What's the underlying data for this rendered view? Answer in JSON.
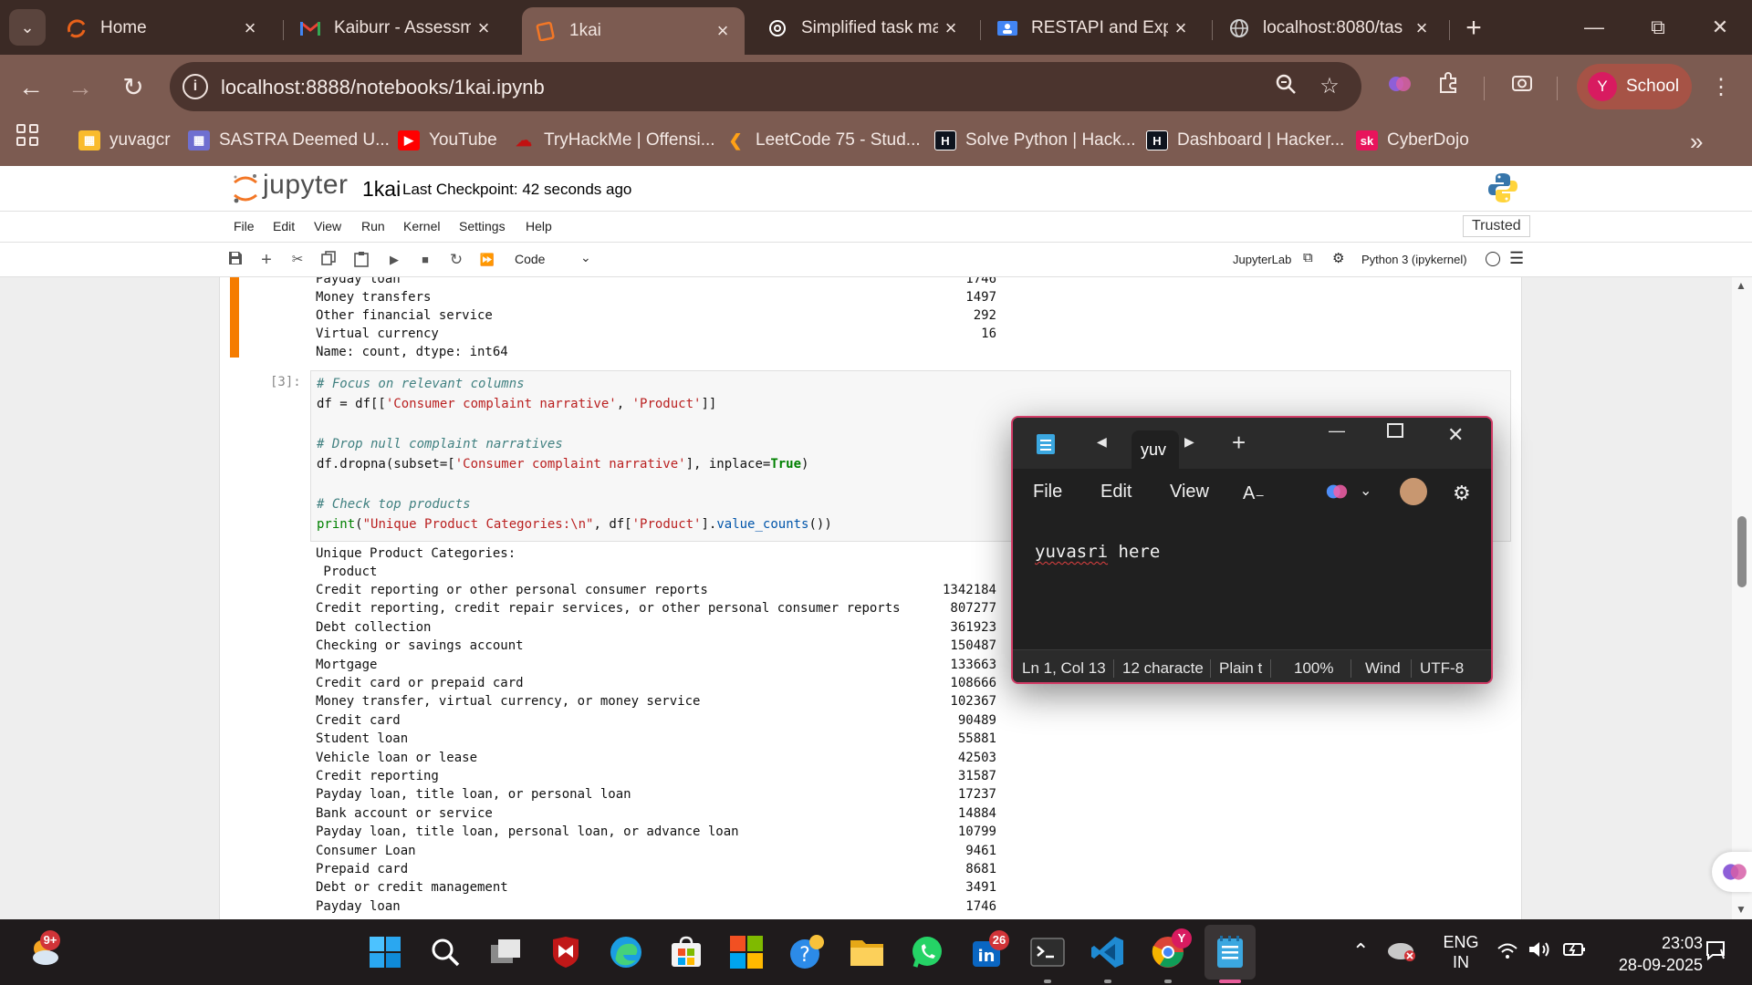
{
  "browser": {
    "tabs": [
      {
        "title": "Home",
        "favicon": "arc-logo-icon",
        "color": "#e8611a"
      },
      {
        "title": "Kaiburr - Assessme",
        "favicon": "gmail-icon",
        "color": "#ea4335"
      },
      {
        "title": "1kai",
        "favicon": "jupyter-icon",
        "color": "#f37726",
        "active": true
      },
      {
        "title": "Simplified task ma",
        "favicon": "chatgpt-icon",
        "color": "#ffffff"
      },
      {
        "title": "RESTAPI and Expre",
        "favicon": "classroom-icon",
        "color": "#4285f4"
      },
      {
        "title": "localhost:8080/tas",
        "favicon": "globe-icon",
        "color": "#d0d0d0"
      }
    ],
    "url": "localhost:8888/notebooks/1kai.ipynb",
    "profile_initial": "Y",
    "profile_label": "School",
    "bookmarks": [
      {
        "label": "yuvagcr",
        "color": "#f9bb2d"
      },
      {
        "label": "SASTRA Deemed U...",
        "color": "#6f6fd0"
      },
      {
        "label": "YouTube",
        "color": "#ff0000"
      },
      {
        "label": "TryHackMe | Offensi...",
        "color": "#c11111"
      },
      {
        "label": "LeetCode 75 - Stud...",
        "color": "#ffa116"
      },
      {
        "label": "Solve Python | Hack...",
        "color": "#0e141e"
      },
      {
        "label": "Dashboard | Hacker...",
        "color": "#0e141e"
      },
      {
        "label": "CyberDojo",
        "color": "#e8145c",
        "text": "sk"
      }
    ]
  },
  "jupyter": {
    "brand": "jupyter",
    "notebook_name": "1kai",
    "checkpoint": "Last Checkpoint: 42 seconds ago",
    "menus": [
      "File",
      "Edit",
      "View",
      "Run",
      "Kernel",
      "Settings",
      "Help"
    ],
    "trusted": "Trusted",
    "cell_type": "Code",
    "jupyterlab_label": "JupyterLab",
    "kernel": "Python 3 (ipykernel)"
  },
  "prev_output": {
    "partial_line": "Payday loan",
    "partial_value": "1746",
    "rows": [
      {
        "label": "Money transfers",
        "value": "1497"
      },
      {
        "label": "Other financial service",
        "value": "292"
      },
      {
        "label": "Virtual currency",
        "value": "16"
      }
    ],
    "footer": "Name: count, dtype: int64"
  },
  "cell3": {
    "prompt": "[3]:",
    "comment1": "# Focus on relevant columns",
    "line2a": "df = df[[",
    "line2s1": "'Consumer complaint narrative'",
    "line2b": ", ",
    "line2s2": "'Product'",
    "line2c": "]]",
    "comment2": "# Drop null complaint narratives",
    "line5a": "df.dropna(subset=[",
    "line5s": "'Consumer complaint narrative'",
    "line5b": "], inplace=",
    "line5kw": "True",
    "line5c": ")",
    "comment3": "# Check top products",
    "line8fn": "print",
    "line8a": "(",
    "line8s": "\"Unique Product Categories:\\n\"",
    "line8b": ", df[",
    "line8s2": "'Product'",
    "line8c": "].",
    "line8fn2": "value_counts",
    "line8d": "())"
  },
  "cell3_output": {
    "header1": "Unique Product Categories:",
    "header2": " Product",
    "rows": [
      {
        "label": "Credit reporting or other personal consumer reports",
        "value": "1342184"
      },
      {
        "label": "Credit reporting, credit repair services, or other personal consumer reports",
        "value": "807277"
      },
      {
        "label": "Debt collection",
        "value": "361923"
      },
      {
        "label": "Checking or savings account",
        "value": "150487"
      },
      {
        "label": "Mortgage",
        "value": "133663"
      },
      {
        "label": "Credit card or prepaid card",
        "value": "108666"
      },
      {
        "label": "Money transfer, virtual currency, or money service",
        "value": "102367"
      },
      {
        "label": "Credit card",
        "value": "90489"
      },
      {
        "label": "Student loan",
        "value": "55881"
      },
      {
        "label": "Vehicle loan or lease",
        "value": "42503"
      },
      {
        "label": "Credit reporting",
        "value": "31587"
      },
      {
        "label": "Payday loan, title loan, or personal loan",
        "value": "17237"
      },
      {
        "label": "Bank account or service",
        "value": "14884"
      },
      {
        "label": "Payday loan, title loan, personal loan, or advance loan",
        "value": "10799"
      },
      {
        "label": "Consumer Loan",
        "value": "9461"
      },
      {
        "label": "Prepaid card",
        "value": "8681"
      },
      {
        "label": "Debt or credit management",
        "value": "3491"
      },
      {
        "label": "Payday loan",
        "value": "1746"
      }
    ]
  },
  "notepad": {
    "tab_title": "yuv",
    "menus": [
      "File",
      "Edit",
      "View"
    ],
    "content_word1": "yuvasri",
    "content_rest": " here",
    "status": {
      "position": "Ln 1, Col 13",
      "chars": "12 characte",
      "format": "Plain t",
      "zoom": "100%",
      "eol": "Wind",
      "encoding": "UTF-8"
    }
  },
  "taskbar": {
    "weather_badge": "9+",
    "linkedin_badge": "26",
    "chrome_badge": "Y",
    "lang_line1": "ENG",
    "lang_line2": "IN",
    "time": "23:03",
    "date": "28-09-2025"
  }
}
